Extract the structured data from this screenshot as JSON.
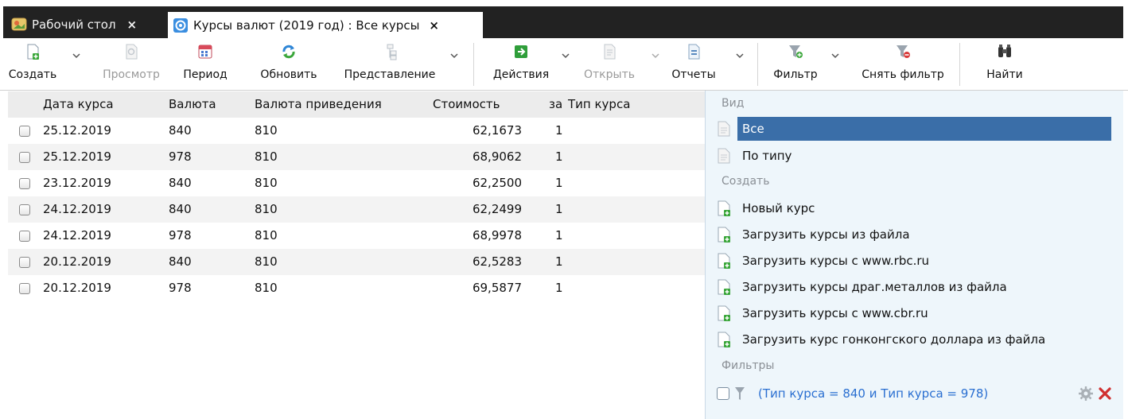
{
  "tabs": [
    {
      "label": "Рабочий стол",
      "close": "×",
      "icon": "desktop-icon"
    },
    {
      "label": "Курсы валют (2019 год) : Все курсы",
      "close": "×",
      "icon": "currency-app-icon"
    }
  ],
  "toolbar": {
    "create": "Создать",
    "view": "Просмотр",
    "period": "Период",
    "refresh": "Обновить",
    "representation": "Представление",
    "actions": "Действия",
    "open": "Открыть",
    "reports": "Отчеты",
    "filter": "Фильтр",
    "clear_filter": "Снять фильтр",
    "find": "Найти"
  },
  "grid": {
    "columns": [
      "Дата курса",
      "Валюта",
      "Валюта приведения",
      "Стоимость",
      "за",
      "Тип курса"
    ],
    "rows": [
      {
        "date": "25.12.2019",
        "currency": "840",
        "base": "810",
        "price": "62,1673",
        "per": "1",
        "type": ""
      },
      {
        "date": "25.12.2019",
        "currency": "978",
        "base": "810",
        "price": "68,9062",
        "per": "1",
        "type": ""
      },
      {
        "date": "23.12.2019",
        "currency": "840",
        "base": "810",
        "price": "62,2500",
        "per": "1",
        "type": ""
      },
      {
        "date": "24.12.2019",
        "currency": "840",
        "base": "810",
        "price": "62,2499",
        "per": "1",
        "type": ""
      },
      {
        "date": "24.12.2019",
        "currency": "978",
        "base": "810",
        "price": "68,9978",
        "per": "1",
        "type": ""
      },
      {
        "date": "20.12.2019",
        "currency": "840",
        "base": "810",
        "price": "62,5283",
        "per": "1",
        "type": ""
      },
      {
        "date": "20.12.2019",
        "currency": "978",
        "base": "810",
        "price": "69,5877",
        "per": "1",
        "type": ""
      }
    ]
  },
  "panel": {
    "view_section": "Вид",
    "view_items": [
      "Все",
      "По типу"
    ],
    "create_section": "Создать",
    "create_items": [
      "Новый курс",
      "Загрузить курсы из файла",
      "Загрузить курсы с www.rbc.ru",
      "Загрузить курсы драг.металлов из файла",
      "Загрузить курсы с www.cbr.ru",
      "Загрузить курс гонконгского доллара из файла"
    ],
    "filters_section": "Фильтры",
    "filter_text": "(Тип курса = 840 и Тип курса = 978)"
  },
  "colors": {
    "tabbar": "#222222",
    "selection": "#3a6ea8",
    "panel_bg": "#eef6fb",
    "link": "#2a6fd1"
  }
}
